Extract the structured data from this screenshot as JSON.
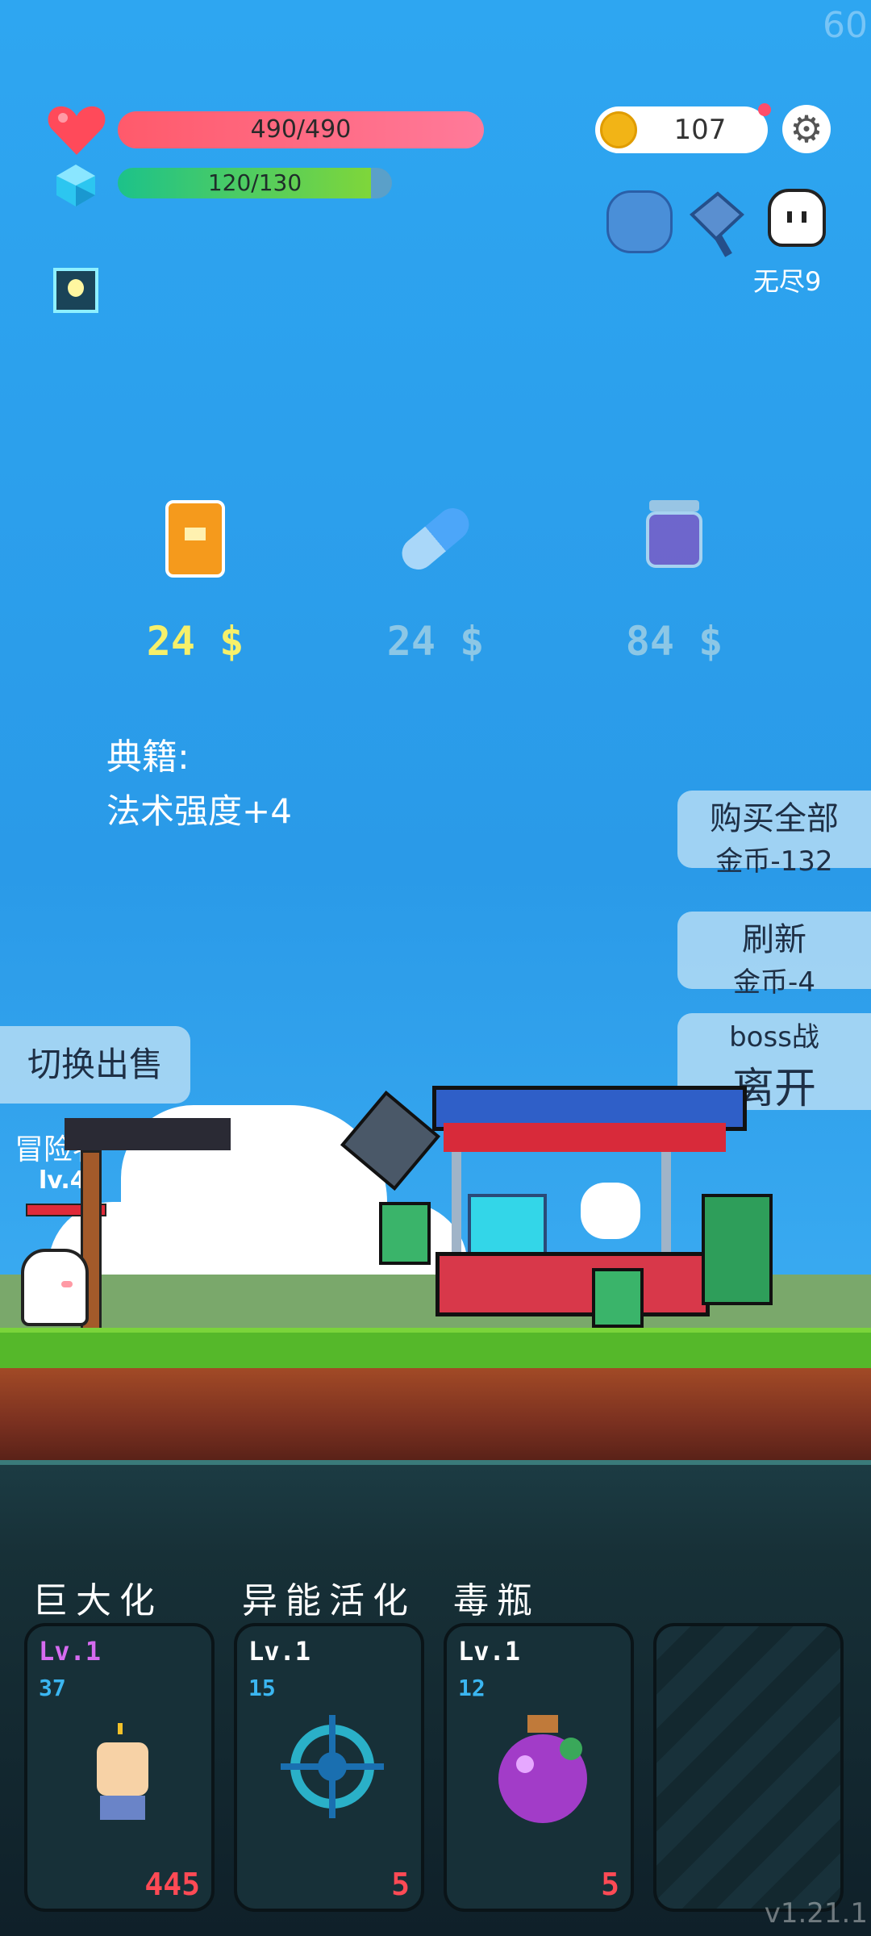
{
  "fps": "60",
  "hud": {
    "hp_text": "490/490",
    "hp": {
      "current": 490,
      "max": 490
    },
    "mp_text": "120/130",
    "mp": {
      "current": 120,
      "max": 130
    },
    "coins": "107",
    "mode_label": "无尽9"
  },
  "shop": {
    "items": [
      {
        "icon": "book-icon",
        "price": "24 $",
        "price_color": "#f6f06a"
      },
      {
        "icon": "pill-icon",
        "price": "24 $",
        "price_color": "#8cc7e6"
      },
      {
        "icon": "jar-icon",
        "price": "84 $",
        "price_color": "#8cc7e6"
      }
    ],
    "desc_title": "典籍:",
    "desc_text": "法术强度+4",
    "buy_all": {
      "title": "购买全部",
      "sub": "金币-132"
    },
    "refresh": {
      "title": "刷新",
      "sub": "金币-4"
    },
    "leave": {
      "sub": "boss战",
      "title": "离开"
    },
    "switch_sell": "切换出售"
  },
  "player": {
    "name": "冒险者",
    "level": "lv.4"
  },
  "skills": [
    {
      "name": "巨大化",
      "level": "Lv.1",
      "level_color": "#d66bf0",
      "cost": "37",
      "count": "445",
      "icon": "hand-icon"
    },
    {
      "name": "异能活化",
      "level": "Lv.1",
      "level_color": "#ffffff",
      "cost": "15",
      "count": "5",
      "icon": "target-icon"
    },
    {
      "name": "毒瓶",
      "level": "Lv.1",
      "level_color": "#ffffff",
      "cost": "12",
      "count": "5",
      "icon": "poison-bottle-icon"
    }
  ],
  "version": "v1.21.1"
}
